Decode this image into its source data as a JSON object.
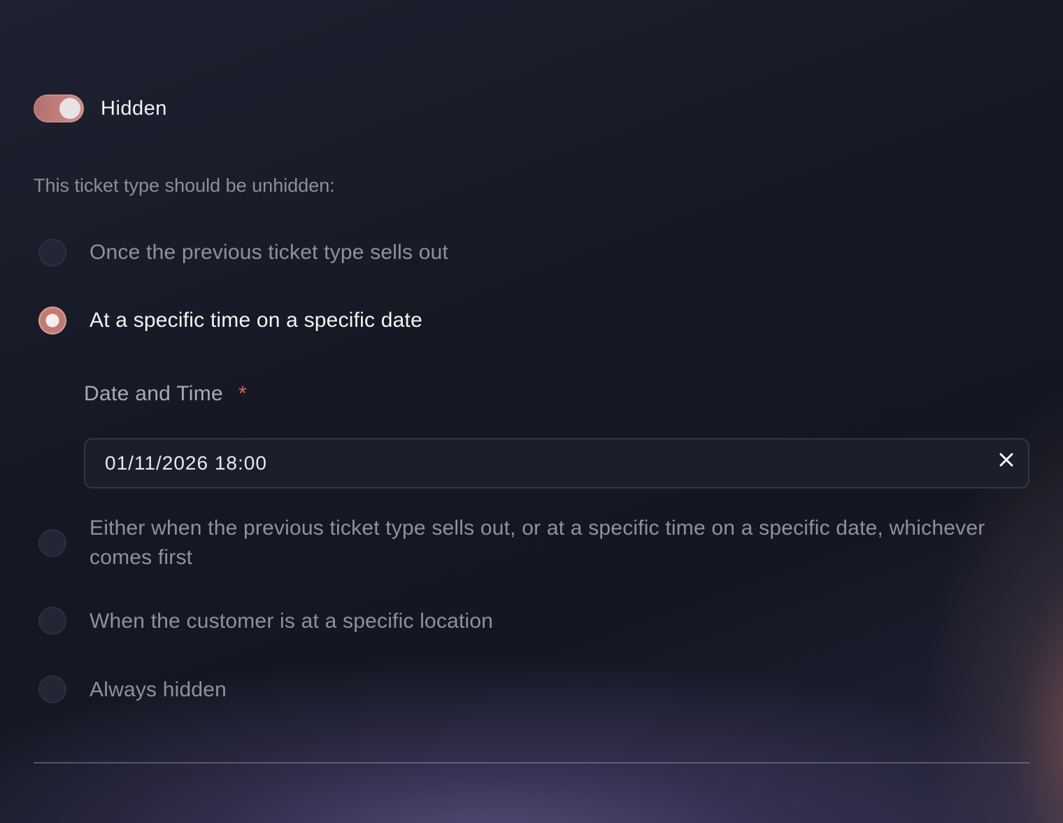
{
  "toggle": {
    "label": "Hidden",
    "on": true
  },
  "prompt": "This ticket type should be unhidden:",
  "options": [
    {
      "label": "Once the previous ticket type sells out",
      "selected": false
    },
    {
      "label": "At a specific time on a specific date",
      "selected": true
    },
    {
      "label": "Either when the previous ticket type sells out, or at a specific time on a specific date, whichever comes first",
      "selected": false
    },
    {
      "label": "When the customer is at a specific location",
      "selected": false
    },
    {
      "label": "Always hidden",
      "selected": false
    }
  ],
  "date_field": {
    "label": "Date and Time",
    "required_mark": "*",
    "value": "01/11/2026 18:00",
    "clear_icon": "close-icon"
  },
  "colors": {
    "accent": "#c27a75",
    "required": "#e0605c"
  }
}
